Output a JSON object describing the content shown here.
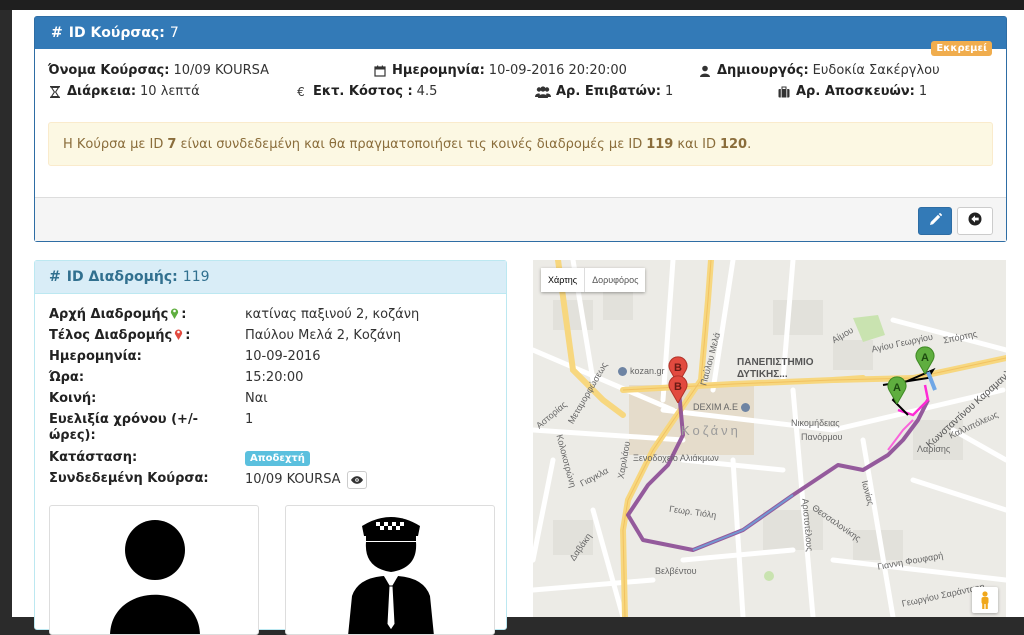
{
  "trip": {
    "header_label": "ID Κούρσας:",
    "id": "7",
    "status_badge": "Εκκρεμεί",
    "name_label": "Όνομα Κούρσας:",
    "name_value": "10/09 KOURSA",
    "date_label": "Ημερομηνία:",
    "date_value": "10-09-2016 20:20:00",
    "creator_label": "Δημιουργός:",
    "creator_value": "Ευδοκία Σακέργλου",
    "duration_label": "Διάρκεια:",
    "duration_value": "10 λεπτά",
    "cost_label": "Εκτ. Κόστος :",
    "cost_value": "4.5",
    "passengers_label": "Αρ. Επιβατών:",
    "passengers_value": "1",
    "luggage_label": "Αρ. Αποσκευών:",
    "luggage_value": "1",
    "alert": {
      "part1": "Η Κούρσα με ID",
      "trip_id": "7",
      "part2": "είναι συνδεδεμένη και θα πραγματοποιήσει τις κοινές διαδρομές με ID",
      "route_a": "119",
      "part3": "και ID",
      "route_b": "120",
      "part4": "."
    }
  },
  "route": {
    "header_label": "ID Διαδρομής:",
    "id": "119",
    "rows": {
      "start_label": "Αρχή Διαδρομής",
      "start_value": "κατίνας παξινού 2, κοζάνη",
      "end_label": "Τέλος Διαδρομής",
      "end_value": "Παύλου Μελά 2, Κοζάνη",
      "date_label": "Ημερομηνία:",
      "date_value": "10-09-2016",
      "time_label": "Ώρα:",
      "time_value": "15:20:00",
      "shared_label": "Κοινή:",
      "shared_value": "Ναι",
      "flex_label": "Ευελιξία χρόνου (+/- ώρες):",
      "flex_value": "1",
      "status_label": "Κατάσταση:",
      "status_value": "Αποδεχτή",
      "linked_label": "Συνδεδεμένη Κούρσα:",
      "linked_value": "10/09 KOURSA"
    },
    "colon": ":"
  },
  "map": {
    "type_map": "Χάρτης",
    "type_satellite": "Δορυφόρος",
    "labels": {
      "university": "ΠΑΝΕΠΙΣΤΗΜΙΟ",
      "university2": "ΔΥΤΙΚΗΣ...",
      "city": "Κοζάνη",
      "kozan": "kozan.gr",
      "dexim": "DEXIM A.E",
      "hotel": "Ξενοδοχείο Αλιάκμων",
      "nikomidias": "Νικομήδειας",
      "panormou": "Πανόρμου",
      "larisis": "Λαρίσης",
      "kallipoleos": "Καλλιπόλεως",
      "karamanli": "Κωνσταντίνου Καραμανλή",
      "charilaou": "Χαριλάου",
      "tioli": "Γεωρ. Τιόλη",
      "thessalonikis": "Θεσσαλονίκης",
      "ionias": "Ιωνίας",
      "aristotelous": "Αριστοτέλους",
      "giannifoufari": "Γιαννη Φουφαρή",
      "sarantari": "Γεωργίου Σαράνταρη",
      "velventou": "Βελβέντου",
      "dabaki": "Δαβάκη",
      "apostolou": "Αγίου Γεωργίου",
      "sporti": "Σπόρτης",
      "amou": "Αίμου",
      "giaka": "Γιαγκλα",
      "pavlou": "Παύλου Μελά",
      "metamorfosis": "Μεταμορφώσεως",
      "kolokotroni": "Κολοκοτρώνη",
      "astoria": "Αστορίας",
      "marker_a": "A",
      "marker_b": "B"
    }
  },
  "colors": {
    "primary": "#337ab7",
    "info_bg": "#d9edf7",
    "warning": "#f0ad4e",
    "label_info": "#5bc0de",
    "route_purple": "#8b4a93",
    "route_blue": "#6f9fd8",
    "route_magenta": "#ff2bd6",
    "marker_green": "#5fae3f",
    "marker_red": "#e24a3f"
  }
}
